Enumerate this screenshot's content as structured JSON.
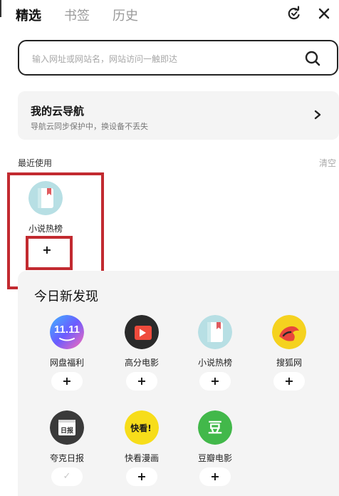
{
  "tabs": [
    {
      "label": "精选",
      "active": true
    },
    {
      "label": "书签",
      "active": false
    },
    {
      "label": "历史",
      "active": false
    }
  ],
  "header": {
    "refresh_icon": "refresh-icon",
    "close_icon": "close-icon"
  },
  "search": {
    "placeholder": "输入网址或网站名，网站访问一触即达",
    "icon": "search-icon"
  },
  "cloud_nav": {
    "title": "我的云导航",
    "subtitle": "导航云同步保护中，换设备不丢失",
    "icon": "chevron-right-icon"
  },
  "recent": {
    "title": "最近使用",
    "clear_label": "清空",
    "items": [
      {
        "label": "小说热榜",
        "icon": "book-icon",
        "action": "+"
      }
    ]
  },
  "discover": {
    "title": "今日新发现",
    "items": [
      {
        "label": "网盘福利",
        "icon": "double-eleven-icon",
        "action": "+"
      },
      {
        "label": "高分电影",
        "icon": "movie-play-icon",
        "action": "+"
      },
      {
        "label": "小说热榜",
        "icon": "book-icon",
        "action": "+"
      },
      {
        "label": "搜狐网",
        "icon": "sohu-fox-icon",
        "action": "+"
      },
      {
        "label": "夸克日报",
        "icon": "daily-news-icon",
        "action": "✓"
      },
      {
        "label": "快看漫画",
        "icon": "kuaikan-comic-icon",
        "action": "+"
      },
      {
        "label": "豆瓣电影",
        "icon": "douban-icon",
        "action": "+"
      }
    ]
  },
  "colors": {
    "highlight": "#c22a30",
    "panel": "#f4f4f4",
    "douban_green": "#42b84a",
    "kuaikan_yellow": "#f7dd1a"
  }
}
